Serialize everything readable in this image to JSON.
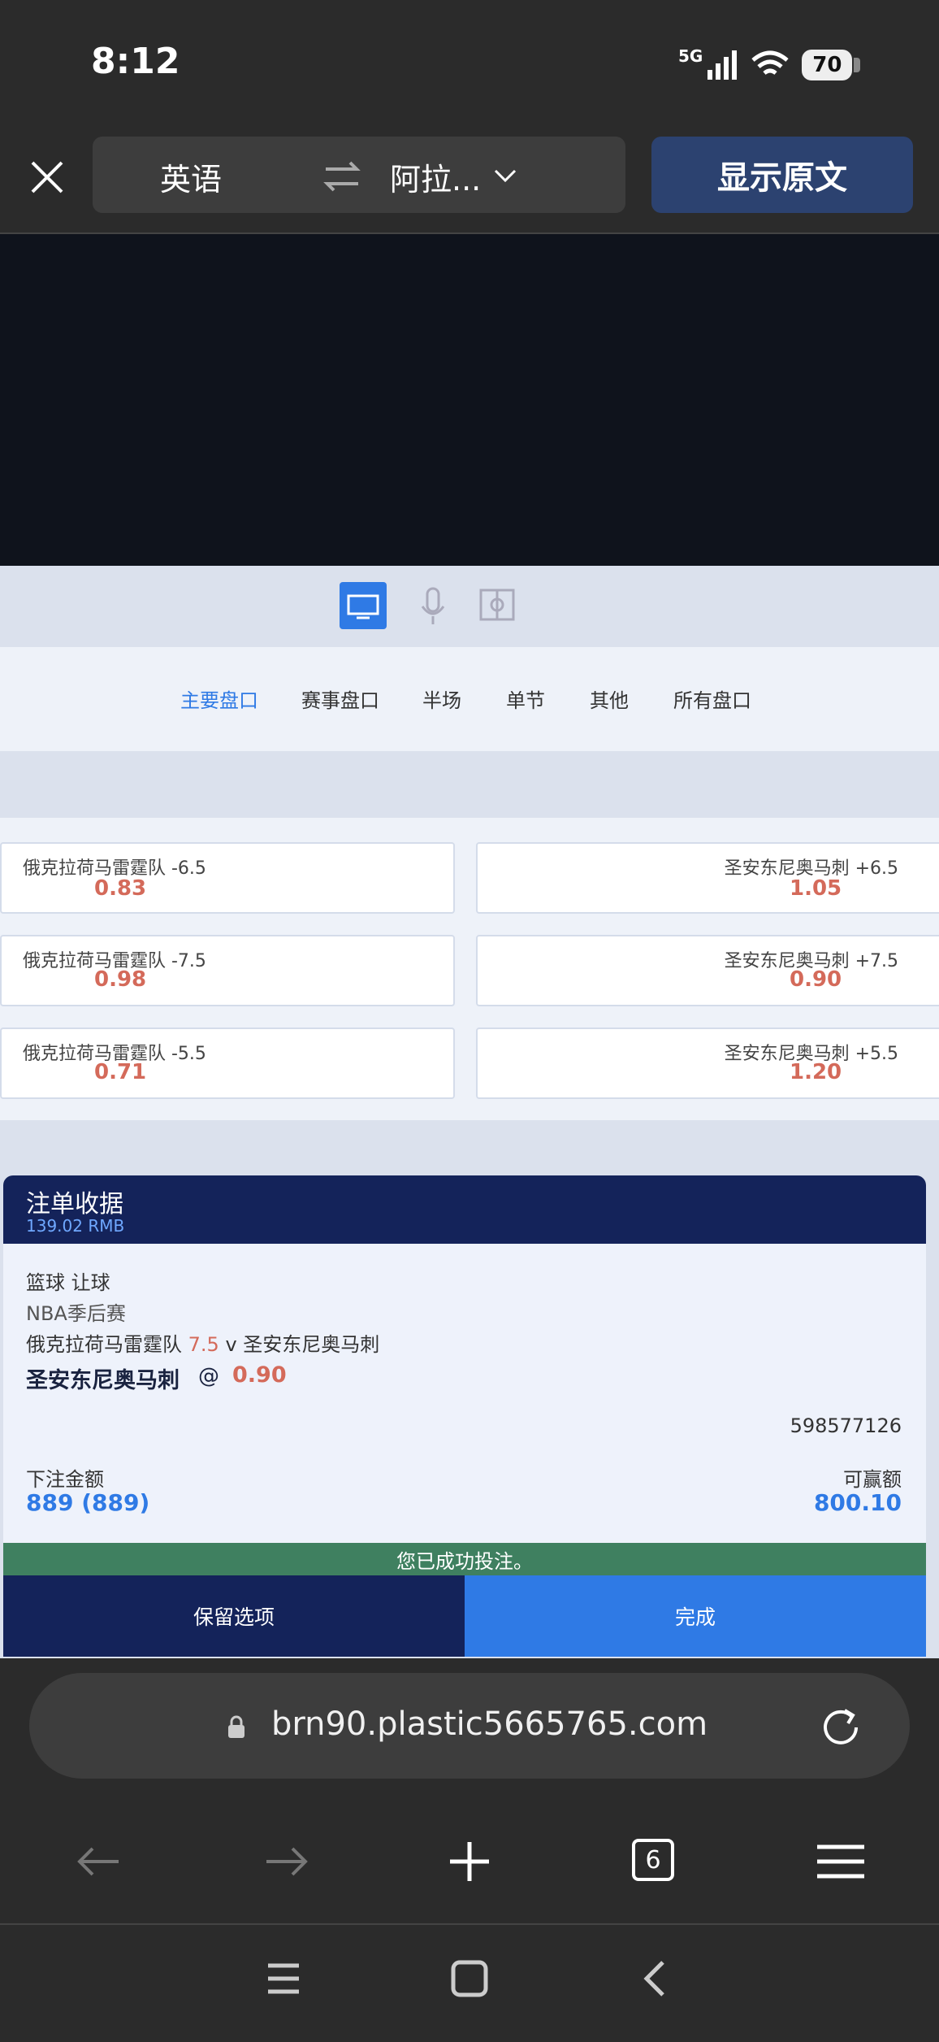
{
  "status_bar": {
    "time": "8:12",
    "network": "5G",
    "battery": "70"
  },
  "translate_bar": {
    "from_lang": "英语",
    "to_lang": "阿拉...",
    "show_original": "显示原文"
  },
  "market_tabs": [
    "主要盘口",
    "赛事盘口",
    "半场",
    "单节",
    "其他",
    "所有盘口"
  ],
  "odds": [
    {
      "home": "俄克拉荷马雷霆队 -6.5",
      "home_odd": "0.83",
      "away": "圣安东尼奥马刺 +6.5",
      "away_odd": "1.05"
    },
    {
      "home": "俄克拉荷马雷霆队 -7.5",
      "home_odd": "0.98",
      "away": "圣安东尼奥马刺 +7.5",
      "away_odd": "0.90"
    },
    {
      "home": "俄克拉荷马雷霆队 -5.5",
      "home_odd": "0.71",
      "away": "圣安东尼奥马刺 +5.5",
      "away_odd": "1.20"
    }
  ],
  "bet_slip": {
    "title": "注单收据",
    "balance": "139.02 RMB",
    "sport_market": "篮球 让球",
    "league": "NBA季后赛",
    "match_home": "俄克拉荷马雷霆队",
    "match_line": "7.5",
    "match_rest": "v 圣安东尼奥马刺",
    "pick": "圣安东尼奥马刺",
    "at": "@",
    "pick_odd": "0.90",
    "ticket_id": "598577126",
    "stake_label": "下注金额",
    "stake_value": "889 (889)",
    "win_label": "可赢额",
    "win_value": "800.10",
    "success_msg": "您已成功投注。",
    "keep_button": "保留选项",
    "done_button": "完成"
  },
  "browser": {
    "url": "brn90.plastic5665765.com",
    "tab_count": "6"
  },
  "colors": {
    "accent": "#2f7ae5",
    "slip_header": "#14235a",
    "odd_value": "#d46a5a",
    "success": "#3f8060"
  }
}
